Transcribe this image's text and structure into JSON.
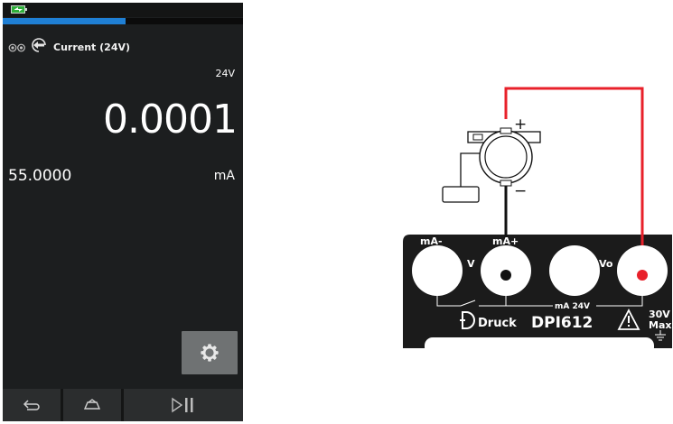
{
  "status": {
    "battery_icon": "battery-charging-icon",
    "progress_fraction": 0.51
  },
  "function_row": {
    "icons": [
      "dual-circle-icon",
      "source-arrow-icon"
    ],
    "label": "Current (24V)"
  },
  "display": {
    "voltage_label": "24V",
    "primary_reading": "0.0001",
    "secondary_reading": "55.0000",
    "unit": "mA"
  },
  "settings": {
    "icon": "gear-icon"
  },
  "bottom_bar": {
    "icons": [
      "back-icon",
      "home-icon",
      "play-pause-icon"
    ]
  },
  "diagram": {
    "terminal_labels": [
      "mA-",
      "mA+",
      "V",
      "Vo",
      "mA 24V"
    ],
    "brand": "Druck",
    "model": "DPI612",
    "warning_value": "30V",
    "warning_suffix": "Max",
    "plus_sign": "+",
    "minus_sign": "−",
    "colors": {
      "red_wire": "#e8202a",
      "black_wire": "#111111",
      "panel": "#1b1b1b"
    }
  }
}
